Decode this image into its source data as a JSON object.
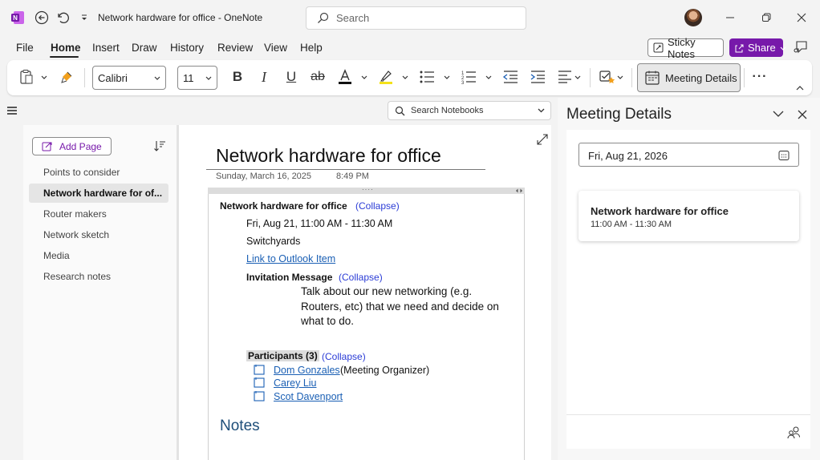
{
  "titlebar": {
    "title": "Network hardware for office  -  OneNote",
    "search_placeholder": "Search"
  },
  "menu": {
    "items": [
      "File",
      "Home",
      "Insert",
      "Draw",
      "History",
      "Review",
      "View",
      "Help"
    ],
    "sticky_notes": "Sticky Notes",
    "share": "Share"
  },
  "ribbon": {
    "font_name": "Calibri",
    "font_size": "11",
    "meeting_details": "Meeting Details"
  },
  "sidebar": {
    "add_page": "Add Page",
    "pages": [
      "Points to consider",
      "Network hardware for of...",
      "Router makers",
      "Network sketch",
      "Media",
      "Research notes"
    ],
    "selected_index": 1
  },
  "notebook_search": "Search Notebooks",
  "page": {
    "title": "Network hardware for office",
    "date": "Sunday, March 16, 2025",
    "time": "8:49 PM",
    "meeting_title": "Network hardware for office",
    "collapse": "(Collapse)",
    "meeting_time": "Fri, Aug 21, 11:00 AM - 11:30 AM",
    "location": "Switchyards",
    "outlook_link": "Link to Outlook Item",
    "invitation_label": "Invitation Message",
    "invitation_lines": [
      "Talk about our new networking (e.g.",
      "Routers, etc) that we need and decide on",
      "what to do."
    ],
    "participants_label": "Participants (3)",
    "participants": [
      {
        "name": "Dom Gonzales",
        "role": "(Meeting Organizer)"
      },
      {
        "name": "Carey Liu",
        "role": ""
      },
      {
        "name": "Scot Davenport",
        "role": ""
      }
    ],
    "notes_heading": "Notes"
  },
  "pane": {
    "title": "Meeting Details",
    "date": "Fri, Aug 21, 2026",
    "meeting_title": "Network hardware for office",
    "meeting_time": "11:00 AM - 11:30 AM"
  },
  "colors": {
    "onenote_purple": "#7719aa",
    "link_blue": "#1a5fb4"
  }
}
